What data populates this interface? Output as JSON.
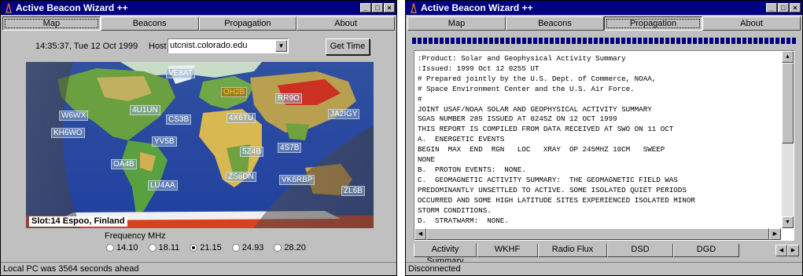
{
  "left": {
    "title": "Active Beacon Wizard ++",
    "tabs": [
      "Map",
      "Beacons",
      "Propagation",
      "About"
    ],
    "active_tab": 0,
    "datetime": "14:35:37, Tue 12 Oct 1999",
    "host_label": "Host",
    "host_value": "utcnist.colorado.edu",
    "get_time_label": "Get Time",
    "map": {
      "callsigns": [
        "VE8AT",
        "OH2B",
        "RR9O",
        "JA2IGY",
        "W6WX",
        "4U1UN",
        "CS3B",
        "4X6TU",
        "KH6WO",
        "YV5B",
        "4S7B",
        "5Z4B",
        "OA4B",
        "ZS6DN",
        "VK6RBP",
        "LU4AA",
        "ZL6B"
      ],
      "highlight": "OH2B",
      "slot_label": "Slot:14 Espoo, Finland"
    },
    "frequency": {
      "title": "Frequency MHz",
      "options": [
        "14.10",
        "18.11",
        "21.15",
        "24.93",
        "28.20"
      ],
      "selected": "21.15"
    },
    "status": "Local PC was 3564 seconds ahead"
  },
  "right": {
    "title": "Active Beacon Wizard ++",
    "tabs": [
      "Map",
      "Beacons",
      "Propagation",
      "About"
    ],
    "active_tab": 2,
    "report_lines": [
      ":Product: Solar and Geophysical Activity Summary",
      ":Issued: 1999 Oct 12 0255 UT",
      "# Prepared jointly by the U.S. Dept. of Commerce, NOAA,",
      "# Space Environment Center and the U.S. Air Force.",
      "#",
      "JOINT USAF/NOAA SOLAR AND GEOPHYSICAL ACTIVITY SUMMARY",
      "SGAS NUMBER 285 ISSUED AT 0245Z ON 12 OCT 1999",
      "THIS REPORT IS COMPILED FROM DATA RECEIVED AT SWO ON 11 OCT",
      "A.  ENERGETIC EVENTS",
      "BEGIN  MAX  END  RGN   LOC   XRAY  OP 245MHZ 10CM   SWEEP",
      "NONE",
      "B.  PROTON EVENTS:  NONE.",
      "C.  GEOMAGNETIC ACTIVITY SUMMARY:  THE GEOMAGNETIC FIELD WAS",
      "PREDOMINANTLY UNSETTLED TO ACTIVE. SOME ISOLATED QUIET PERIODS",
      "OCCURRED AND SOME HIGH LATITUDE SITES EXPERIENCED ISOLATED MINOR",
      "STORM CONDITIONS.",
      "D.  STRATWARM:  NONE."
    ],
    "bottom_tabs": [
      "Activity Summary",
      "WKHF",
      "Radio Flux",
      "DSD",
      "DGD"
    ],
    "active_bottom_tab": 0,
    "status": "Disconnected"
  }
}
